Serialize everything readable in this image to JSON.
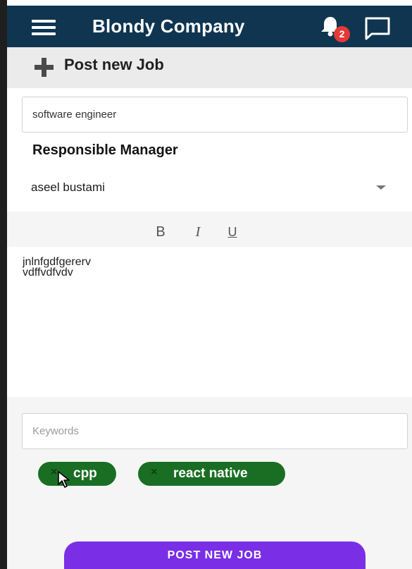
{
  "app_bar": {
    "title": "Blondy Company",
    "notification_count": "2",
    "background_color": "#0f3550",
    "icons": [
      "menu-icon",
      "bell-icon",
      "chat-icon"
    ]
  },
  "post_header": {
    "label": "Post new Job",
    "icon": "plus-icon"
  },
  "job_title_field": {
    "value": "software engineer"
  },
  "responsible_manager": {
    "label": "Responsible Manager",
    "selected": "aseel bustami",
    "icon": "caret-down-icon"
  },
  "formatting": {
    "bold": "B",
    "italic": "I",
    "underline": "U"
  },
  "description": {
    "lines": [
      "jnlnfgdfgererv",
      "vdffvdfvdv"
    ]
  },
  "keywords_field": {
    "placeholder": "Keywords"
  },
  "keywords": [
    {
      "label": "cpp",
      "remove": "×"
    },
    {
      "label": "react native",
      "remove": "×"
    }
  ],
  "chip_color": "#1a6e23",
  "submit_button": {
    "label": "POST NEW JOB",
    "color": "#7a2fe6"
  }
}
